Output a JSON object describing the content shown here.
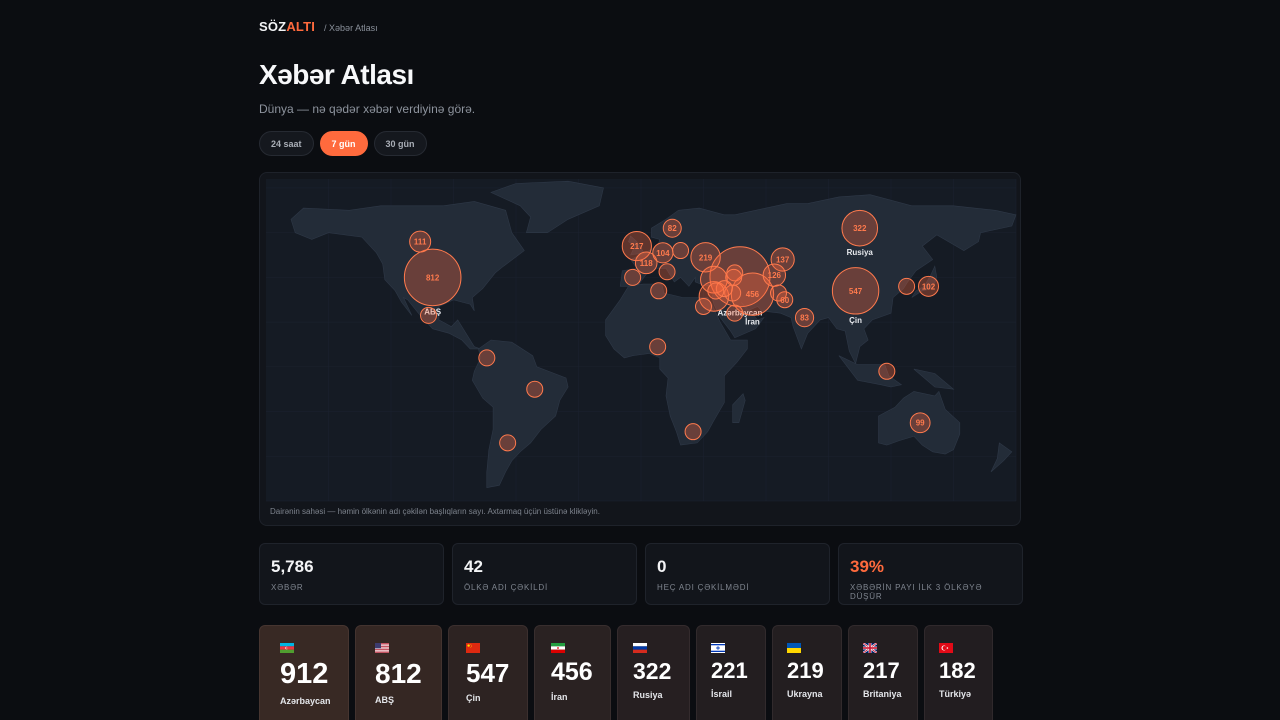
{
  "header": {
    "logo_main": "SÖZ",
    "logo_accent": "ALTI",
    "breadcrumb": "/ Xəbər Atlası"
  },
  "page": {
    "title": "Xəbər Atlası",
    "subtitle": "Dünya — nə qədər xəbər verdiyinə görə."
  },
  "tabs": [
    {
      "label": "24 saat",
      "active": false
    },
    {
      "label": "7 gün",
      "active": true
    },
    {
      "label": "30 gün",
      "active": false
    }
  ],
  "map": {
    "note": "Dairənin sahəsi — həmin ölkənin adı çəkilən başlıqların sayı. Axtarmaq üçün üstünə klikləyin.",
    "bubbles": [
      {
        "name": "Azərbaycan",
        "value": 912,
        "lon": 47.5,
        "lat": 40.3,
        "show_value": false,
        "show_name": true
      },
      {
        "name": "ABŞ",
        "value": 812,
        "lon": -100,
        "lat": 40,
        "show_value": true,
        "show_name": true
      },
      {
        "name": "Çin",
        "value": 547,
        "lon": 103,
        "lat": 34,
        "show_value": true,
        "show_name": true
      },
      {
        "name": "İran",
        "value": 456,
        "lon": 53.5,
        "lat": 32.5,
        "show_value": true,
        "show_name": true
      },
      {
        "name": "Rusiya",
        "value": 322,
        "lon": 105,
        "lat": 62,
        "show_value": true,
        "show_name": true
      },
      {
        "name": "İsrail",
        "value": 221,
        "lon": 35,
        "lat": 31.5,
        "show_value": false,
        "show_name": false
      },
      {
        "name": "Ukrayna",
        "value": 219,
        "lon": 31,
        "lat": 49,
        "show_value": true,
        "show_name": false
      },
      {
        "name": "Britaniya",
        "value": 217,
        "lon": -2,
        "lat": 54,
        "show_value": true,
        "show_name": false
      },
      {
        "name": "Türkiyə",
        "value": 182,
        "lon": 35,
        "lat": 39,
        "show_value": false,
        "show_name": false
      },
      {
        "name": "",
        "value": 137,
        "lon": 68,
        "lat": 48,
        "show_value": true,
        "show_name": false
      },
      {
        "name": "",
        "value": 126,
        "lon": 64,
        "lat": 41,
        "show_value": true,
        "show_name": false
      },
      {
        "name": "",
        "value": 118,
        "lon": 2.5,
        "lat": 46.5,
        "show_value": true,
        "show_name": false
      },
      {
        "name": "",
        "value": 111,
        "lon": -106,
        "lat": 56,
        "show_value": true,
        "show_name": false
      },
      {
        "name": "",
        "value": 104,
        "lon": 10.5,
        "lat": 51,
        "show_value": true,
        "show_name": false
      },
      {
        "name": "",
        "value": 102,
        "lon": 138,
        "lat": 36,
        "show_value": true,
        "show_name": false
      },
      {
        "name": "",
        "value": 99,
        "lon": 134,
        "lat": -25,
        "show_value": true,
        "show_name": false
      },
      {
        "name": "",
        "value": 83,
        "lon": 78.5,
        "lat": 22,
        "show_value": true,
        "show_name": false
      },
      {
        "name": "",
        "value": 82,
        "lon": 15,
        "lat": 62,
        "show_value": true,
        "show_name": false
      },
      {
        "name": "",
        "value": 60,
        "lon": 69,
        "lat": 30,
        "show_value": true,
        "show_name": false
      },
      {
        "name": "",
        "value": 55,
        "lon": 127.5,
        "lat": 36,
        "show_value": false,
        "show_name": false
      },
      {
        "name": "",
        "value": 50,
        "lon": 44,
        "lat": 33,
        "show_value": false,
        "show_name": false
      },
      {
        "name": "",
        "value": 48,
        "lon": 19,
        "lat": 52,
        "show_value": false,
        "show_name": false
      },
      {
        "name": "",
        "value": 45,
        "lon": 12.5,
        "lat": 42.5,
        "show_value": false,
        "show_name": false
      },
      {
        "name": "",
        "value": 45,
        "lon": -4,
        "lat": 40,
        "show_value": false,
        "show_name": false
      },
      {
        "name": "",
        "value": 45,
        "lon": 45,
        "lat": 24,
        "show_value": false,
        "show_name": false
      },
      {
        "name": "",
        "value": 42,
        "lon": 45,
        "lat": 42,
        "show_value": false,
        "show_name": false
      },
      {
        "name": "",
        "value": 40,
        "lon": 44.5,
        "lat": 40,
        "show_value": false,
        "show_name": false
      },
      {
        "name": "",
        "value": 40,
        "lon": 118,
        "lat": -2,
        "show_value": false,
        "show_name": false
      },
      {
        "name": "",
        "value": 35,
        "lon": 30,
        "lat": 27,
        "show_value": false,
        "show_name": false
      },
      {
        "name": "",
        "value": 35,
        "lon": 40,
        "lat": 35,
        "show_value": false,
        "show_name": false
      },
      {
        "name": "",
        "value": 30,
        "lon": 35.9,
        "lat": 33.9,
        "show_value": false,
        "show_name": false
      },
      {
        "name": "",
        "value": 30,
        "lon": -102,
        "lat": 23,
        "show_value": false,
        "show_name": false
      },
      {
        "name": "",
        "value": 30,
        "lon": -51,
        "lat": -10,
        "show_value": false,
        "show_name": false
      },
      {
        "name": "",
        "value": 30,
        "lon": 25,
        "lat": -29,
        "show_value": false,
        "show_name": false
      },
      {
        "name": "",
        "value": 25,
        "lon": -74,
        "lat": 4,
        "show_value": false,
        "show_name": false
      },
      {
        "name": "",
        "value": 25,
        "lon": -64,
        "lat": -34,
        "show_value": false,
        "show_name": false
      },
      {
        "name": "",
        "value": 25,
        "lon": 8,
        "lat": 9,
        "show_value": false,
        "show_name": false
      },
      {
        "name": "",
        "value": 25,
        "lon": 8.5,
        "lat": 34,
        "show_value": false,
        "show_name": false
      },
      {
        "name": "",
        "value": 25,
        "lon": 66,
        "lat": 33,
        "show_value": false,
        "show_name": false
      }
    ]
  },
  "stats": [
    {
      "value": "5,786",
      "label": "XƏBƏR",
      "accent": false
    },
    {
      "value": "42",
      "label": "ÖLKƏ ADI ÇƏKİLDİ",
      "accent": false
    },
    {
      "value": "0",
      "label": "HEÇ ADI ÇƏKİLMƏDİ",
      "accent": false
    },
    {
      "value": "39%",
      "label": "XƏBƏRİN PAYI İLK 3 ÖLKƏYƏ DÜŞÜR",
      "accent": true
    }
  ],
  "country_cards": [
    {
      "flag": "az-flag",
      "value": "912",
      "name": "Azərbaycan"
    },
    {
      "flag": "us-flag",
      "value": "812",
      "name": "ABŞ"
    },
    {
      "flag": "cn-flag",
      "value": "547",
      "name": "Çin"
    },
    {
      "flag": "ir-flag",
      "value": "456",
      "name": "İran"
    },
    {
      "flag": "ru-flag",
      "value": "322",
      "name": "Rusiya"
    },
    {
      "flag": "il-flag",
      "value": "221",
      "name": "İsrail"
    },
    {
      "flag": "ua-flag",
      "value": "219",
      "name": "Ukrayna"
    },
    {
      "flag": "gb-flag",
      "value": "217",
      "name": "Britaniya"
    },
    {
      "flag": "tr-flag",
      "value": "182",
      "name": "Türkiyə"
    }
  ],
  "colors": {
    "accent": "#ff6a3d",
    "background": "#0b0d11",
    "card_bg": "#12151b"
  }
}
